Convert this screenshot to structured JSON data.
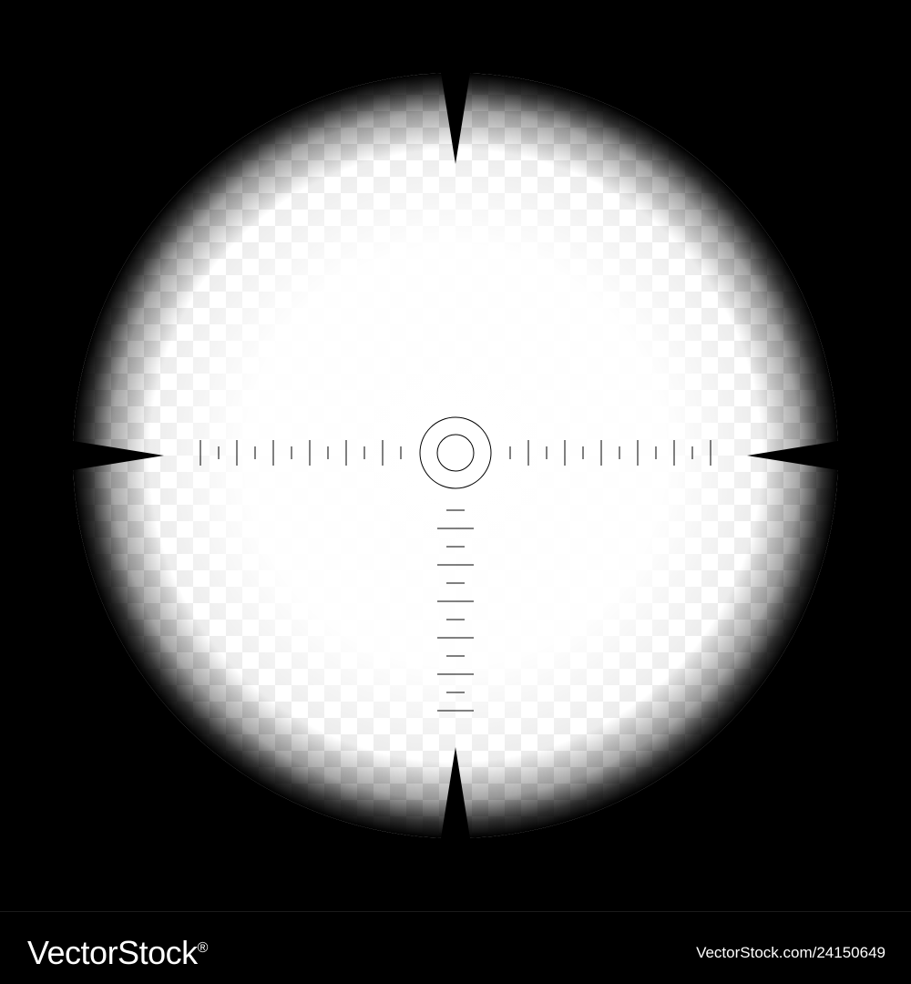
{
  "watermark": {
    "brand": "VectorStock",
    "registered_mark": "®",
    "url": "VectorStock.com/24150649"
  },
  "colors": {
    "background": "#000000",
    "lens_center": "#ffffff",
    "checker_light": "#ffffff",
    "checker_dark": "#e3e3e3",
    "reticle": "#000000"
  },
  "icons": {
    "crosshair": "sniper-scope-reticle-icon"
  },
  "reticle": {
    "horizontal_ticks_per_side": 12,
    "vertical_ticks": 12
  }
}
